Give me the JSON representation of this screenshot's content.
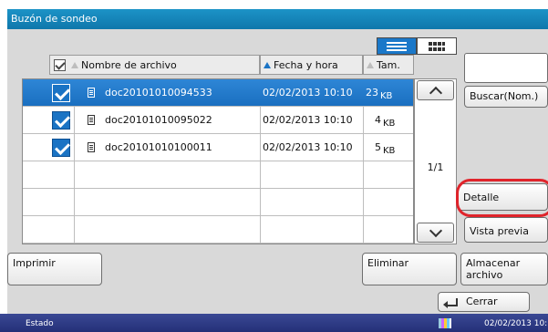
{
  "window": {
    "title": "Buzón de sondeo"
  },
  "view_toggle": {
    "list": "list-view-icon",
    "thumbnail": "thumbnail-view-icon"
  },
  "table": {
    "columns": {
      "name": "Nombre de archivo",
      "datetime": "Fecha y hora",
      "size": "Tam."
    },
    "rows": [
      {
        "name": "doc20101010094533",
        "datetime": "02/02/2013  10:10",
        "size": "23",
        "unit": "KB",
        "selected": true,
        "checked": true
      },
      {
        "name": "doc20101010095022",
        "datetime": "02/02/2013  10:10",
        "size": "4",
        "unit": "KB",
        "selected": false,
        "checked": true
      },
      {
        "name": "doc20101010100011",
        "datetime": "02/02/2013  10:10",
        "size": "5",
        "unit": "KB",
        "selected": false,
        "checked": true
      }
    ]
  },
  "pager": {
    "page": "1/1"
  },
  "side": {
    "search_label": "Buscar(Nom.)",
    "detail_label": "Detalle",
    "preview_label": "Vista previa"
  },
  "actions": {
    "print_label": "Imprimir",
    "delete_label": "Eliminar",
    "store_label_line1": "Almacenar",
    "store_label_line2": "archivo",
    "close_label": "Cerrar"
  },
  "status_bar": {
    "label": "Estado",
    "datetime": "02/02/2013  10:10"
  },
  "colors": {
    "titlebar": "#1586bd",
    "selection": "#1a73c4",
    "highlight_ring": "#e0242b",
    "status_bar": "#2c3a85"
  }
}
